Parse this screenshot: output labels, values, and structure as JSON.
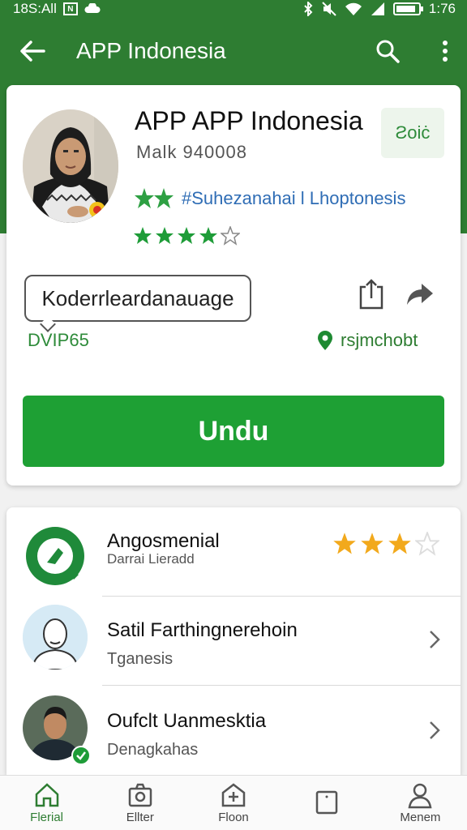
{
  "status_bar": {
    "time_left": "18S:All",
    "time_right": "1:76",
    "box_glyph": "N",
    "battery_level": 0.9
  },
  "app_bar": {
    "title": "APP Indonesia",
    "back_icon": "arrow-left-icon",
    "search_icon": "search-icon",
    "more_icon": "more-vert-icon"
  },
  "app_card": {
    "name": "APP APP Indonesia",
    "tag": "Ƨoiċ",
    "sub_id": "Malk 940008",
    "developer": "#Suhezanahai l Lhoptonesis",
    "rating_stars": 3.5,
    "bubble_text": "Koderrleardanauage",
    "version": "DVIP65",
    "location": "rsjmchobt",
    "install_label": "Undu"
  },
  "list": [
    {
      "title": "Angosmenial",
      "subtitle": "Darrai Lieradd",
      "stars": 3,
      "type": "stars"
    },
    {
      "title": "Satil Farthingnerehoin",
      "subtitle": "Tganesis",
      "type": "chevron"
    },
    {
      "title": "Oufclt Uanmesktia",
      "subtitle": "Denagkahas",
      "type": "chevron"
    }
  ],
  "bottom_nav": [
    {
      "label": "Flerial",
      "icon": "home-icon",
      "active": true
    },
    {
      "label": "Ellter",
      "icon": "camera-icon",
      "active": false
    },
    {
      "label": "Floon",
      "icon": "add-icon",
      "active": false
    },
    {
      "label": "",
      "icon": "square-icon",
      "active": false
    },
    {
      "label": "Menem",
      "icon": "person-icon",
      "active": false
    }
  ],
  "colors": {
    "primary": "#2e7d32",
    "install": "#1ea034",
    "star_gold": "#f2a91c",
    "link_blue": "#2f6db5"
  }
}
